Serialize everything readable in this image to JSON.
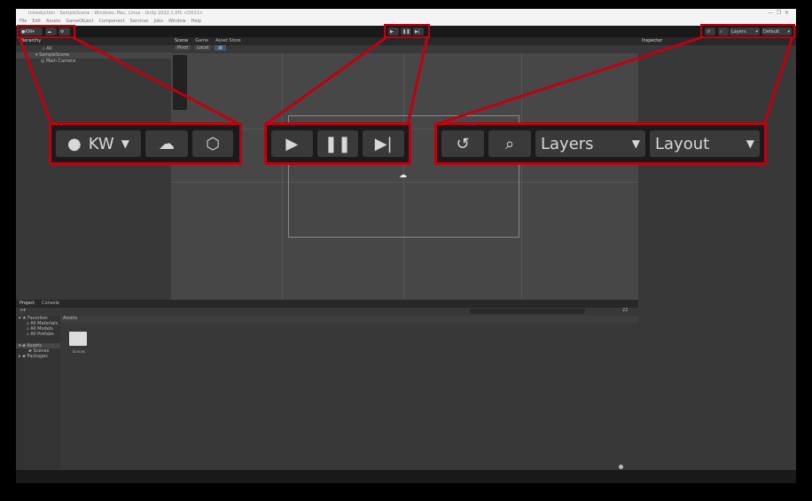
{
  "window": {
    "title": "Introduction - SampleScene - Windows, Mac, Linux - Unity 2022.1.0f1 <DX11>"
  },
  "menu": [
    "File",
    "Edit",
    "Assets",
    "GameObject",
    "Component",
    "Services",
    "Jobs",
    "Window",
    "Help"
  ],
  "toolbar": {
    "account": "KW",
    "layers": "Layers",
    "layout": "Default"
  },
  "hierarchy": {
    "tab": "Hierarchy",
    "search_placeholder": "All",
    "scene": "SampleScene",
    "items": [
      "Main Camera"
    ]
  },
  "scene_tabs": [
    "Scene",
    "Game",
    "Asset Store"
  ],
  "scene_toolbar": {
    "pivot": "Pivot",
    "local": "Local"
  },
  "inspector": {
    "tab": "Inspector"
  },
  "project": {
    "tabs": [
      "Project",
      "Console"
    ],
    "favorites": "Favorites",
    "favorite_items": [
      "All Materials",
      "All Models",
      "All Prefabs"
    ],
    "assets": "Assets",
    "asset_children": [
      "Scenes"
    ],
    "packages": "Packages",
    "breadcrumb": "Assets",
    "folders": [
      "Scenes"
    ],
    "hidden_count": "22"
  },
  "callouts": {
    "account": "KW",
    "layers": "Layers",
    "layout": "Layout"
  },
  "colors": {
    "highlight": "#c00010"
  }
}
